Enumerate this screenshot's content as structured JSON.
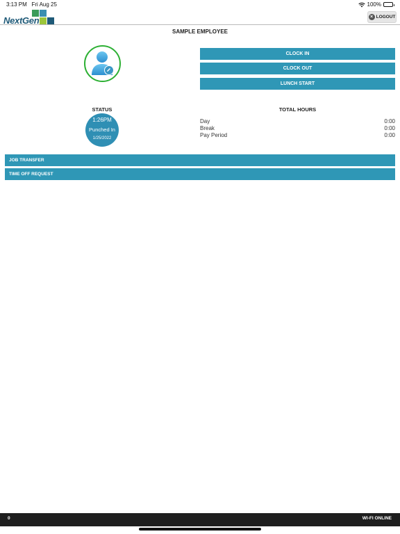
{
  "status_bar": {
    "time": "3:13 PM",
    "date": "Fri Aug 25",
    "battery": "100%"
  },
  "header": {
    "logo_text": "NextGen",
    "logout_label": "LOGOUT",
    "logo_colors": [
      "#3a9c5a",
      "#3a8fb0",
      "#9cc63a",
      "#1f5a78"
    ]
  },
  "employee": {
    "name": "SAMPLE EMPLOYEE"
  },
  "actions": {
    "clock_in": "CLOCK IN",
    "clock_out": "CLOCK OUT",
    "lunch_start": "LUNCH START"
  },
  "status": {
    "label": "STATUS",
    "time": "1:26PM",
    "state": "Punched In",
    "date": "1/25/2022"
  },
  "total_hours": {
    "label": "TOTAL HOURS",
    "rows": [
      {
        "label": "Day",
        "value": "0:00"
      },
      {
        "label": "Break",
        "value": "0:00"
      },
      {
        "label": "Pay Period",
        "value": "0:00"
      }
    ]
  },
  "menu": {
    "job_transfer": "JOB TRANSFER",
    "time_off_request": "TIME OFF REQUEST"
  },
  "footer": {
    "count": "0",
    "network": "WI-FI ONLINE"
  },
  "colors": {
    "accent": "#2f97b6",
    "status_circle": "#2f8fb4",
    "avatar_ring": "#2db034",
    "footer_bg": "#1e1e1e"
  }
}
